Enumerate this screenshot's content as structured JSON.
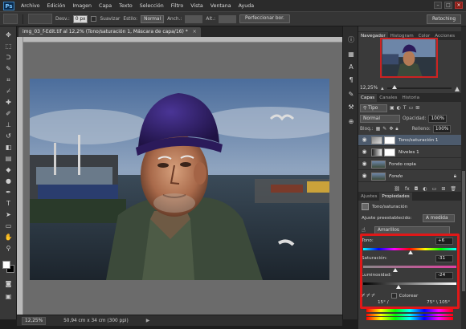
{
  "app": {
    "logo": "Ps"
  },
  "menu": [
    "Archivo",
    "Edición",
    "Imagen",
    "Capa",
    "Texto",
    "Selección",
    "Filtro",
    "Vista",
    "Ventana",
    "Ayuda"
  ],
  "options": {
    "feather_label": "Desv.:",
    "feather_value": "0 px",
    "smooth_label": "Suavizar",
    "style_label": "Estilo:",
    "style_value": "Normal",
    "width_label": "Anch.:",
    "height_label": "Alt.:",
    "refine_button": "Perfeccionar bor.",
    "workspace": "Retoching"
  },
  "document": {
    "tab_title": "img_03_f-Edit.tif al 12,2% (Tono/saturación 1, Máscara de capa/16) *",
    "close": "×"
  },
  "status": {
    "zoom": "12,25%",
    "doc_size": "50,94 cm x 34 cm (300 ppi)",
    "arrow": "▶"
  },
  "navigator": {
    "tabs": [
      "Navegador",
      "Histogram",
      "Color",
      "Acciones"
    ],
    "zoom": "12,25%",
    "zoom_fraction": 0.12
  },
  "layers": {
    "tabs": [
      "Capas",
      "Canales",
      "Historia"
    ],
    "filter": "Tipo",
    "blend_mode": "Normal",
    "opacity_label": "Opacidad:",
    "opacity_value": "100%",
    "lock_label": "Bloq.:",
    "fill_label": "Relleno:",
    "fill_value": "100%",
    "items": [
      {
        "name": "Tono/saturación 1",
        "selected": true
      },
      {
        "name": "Niveles 1",
        "selected": false
      },
      {
        "name": "Fondo copia",
        "selected": false
      },
      {
        "name": "Fondo",
        "selected": false
      }
    ]
  },
  "properties": {
    "tabs": [
      "Ajustes",
      "Propiedades"
    ],
    "title": "Tono/saturación",
    "preset_label": "Ajuste preestablecido:",
    "preset_value": "A medida",
    "channel_value": "Amarillos",
    "hue_label": "Tono:",
    "hue_value": "+6",
    "hue_fraction": 0.508,
    "saturation_label": "Saturación:",
    "saturation_value": "-31",
    "saturation_fraction": 0.345,
    "lightness_label": "Luminosidad:",
    "lightness_value": "-24",
    "lightness_fraction": 0.38,
    "colorize_label": "Colorear",
    "range_left": "15° /",
    "range_right": "75° \\ 105°"
  },
  "colors": {
    "highlight": "#e01818",
    "layer_selected": "#4d5b6d",
    "hat": "#2b1a5a"
  }
}
